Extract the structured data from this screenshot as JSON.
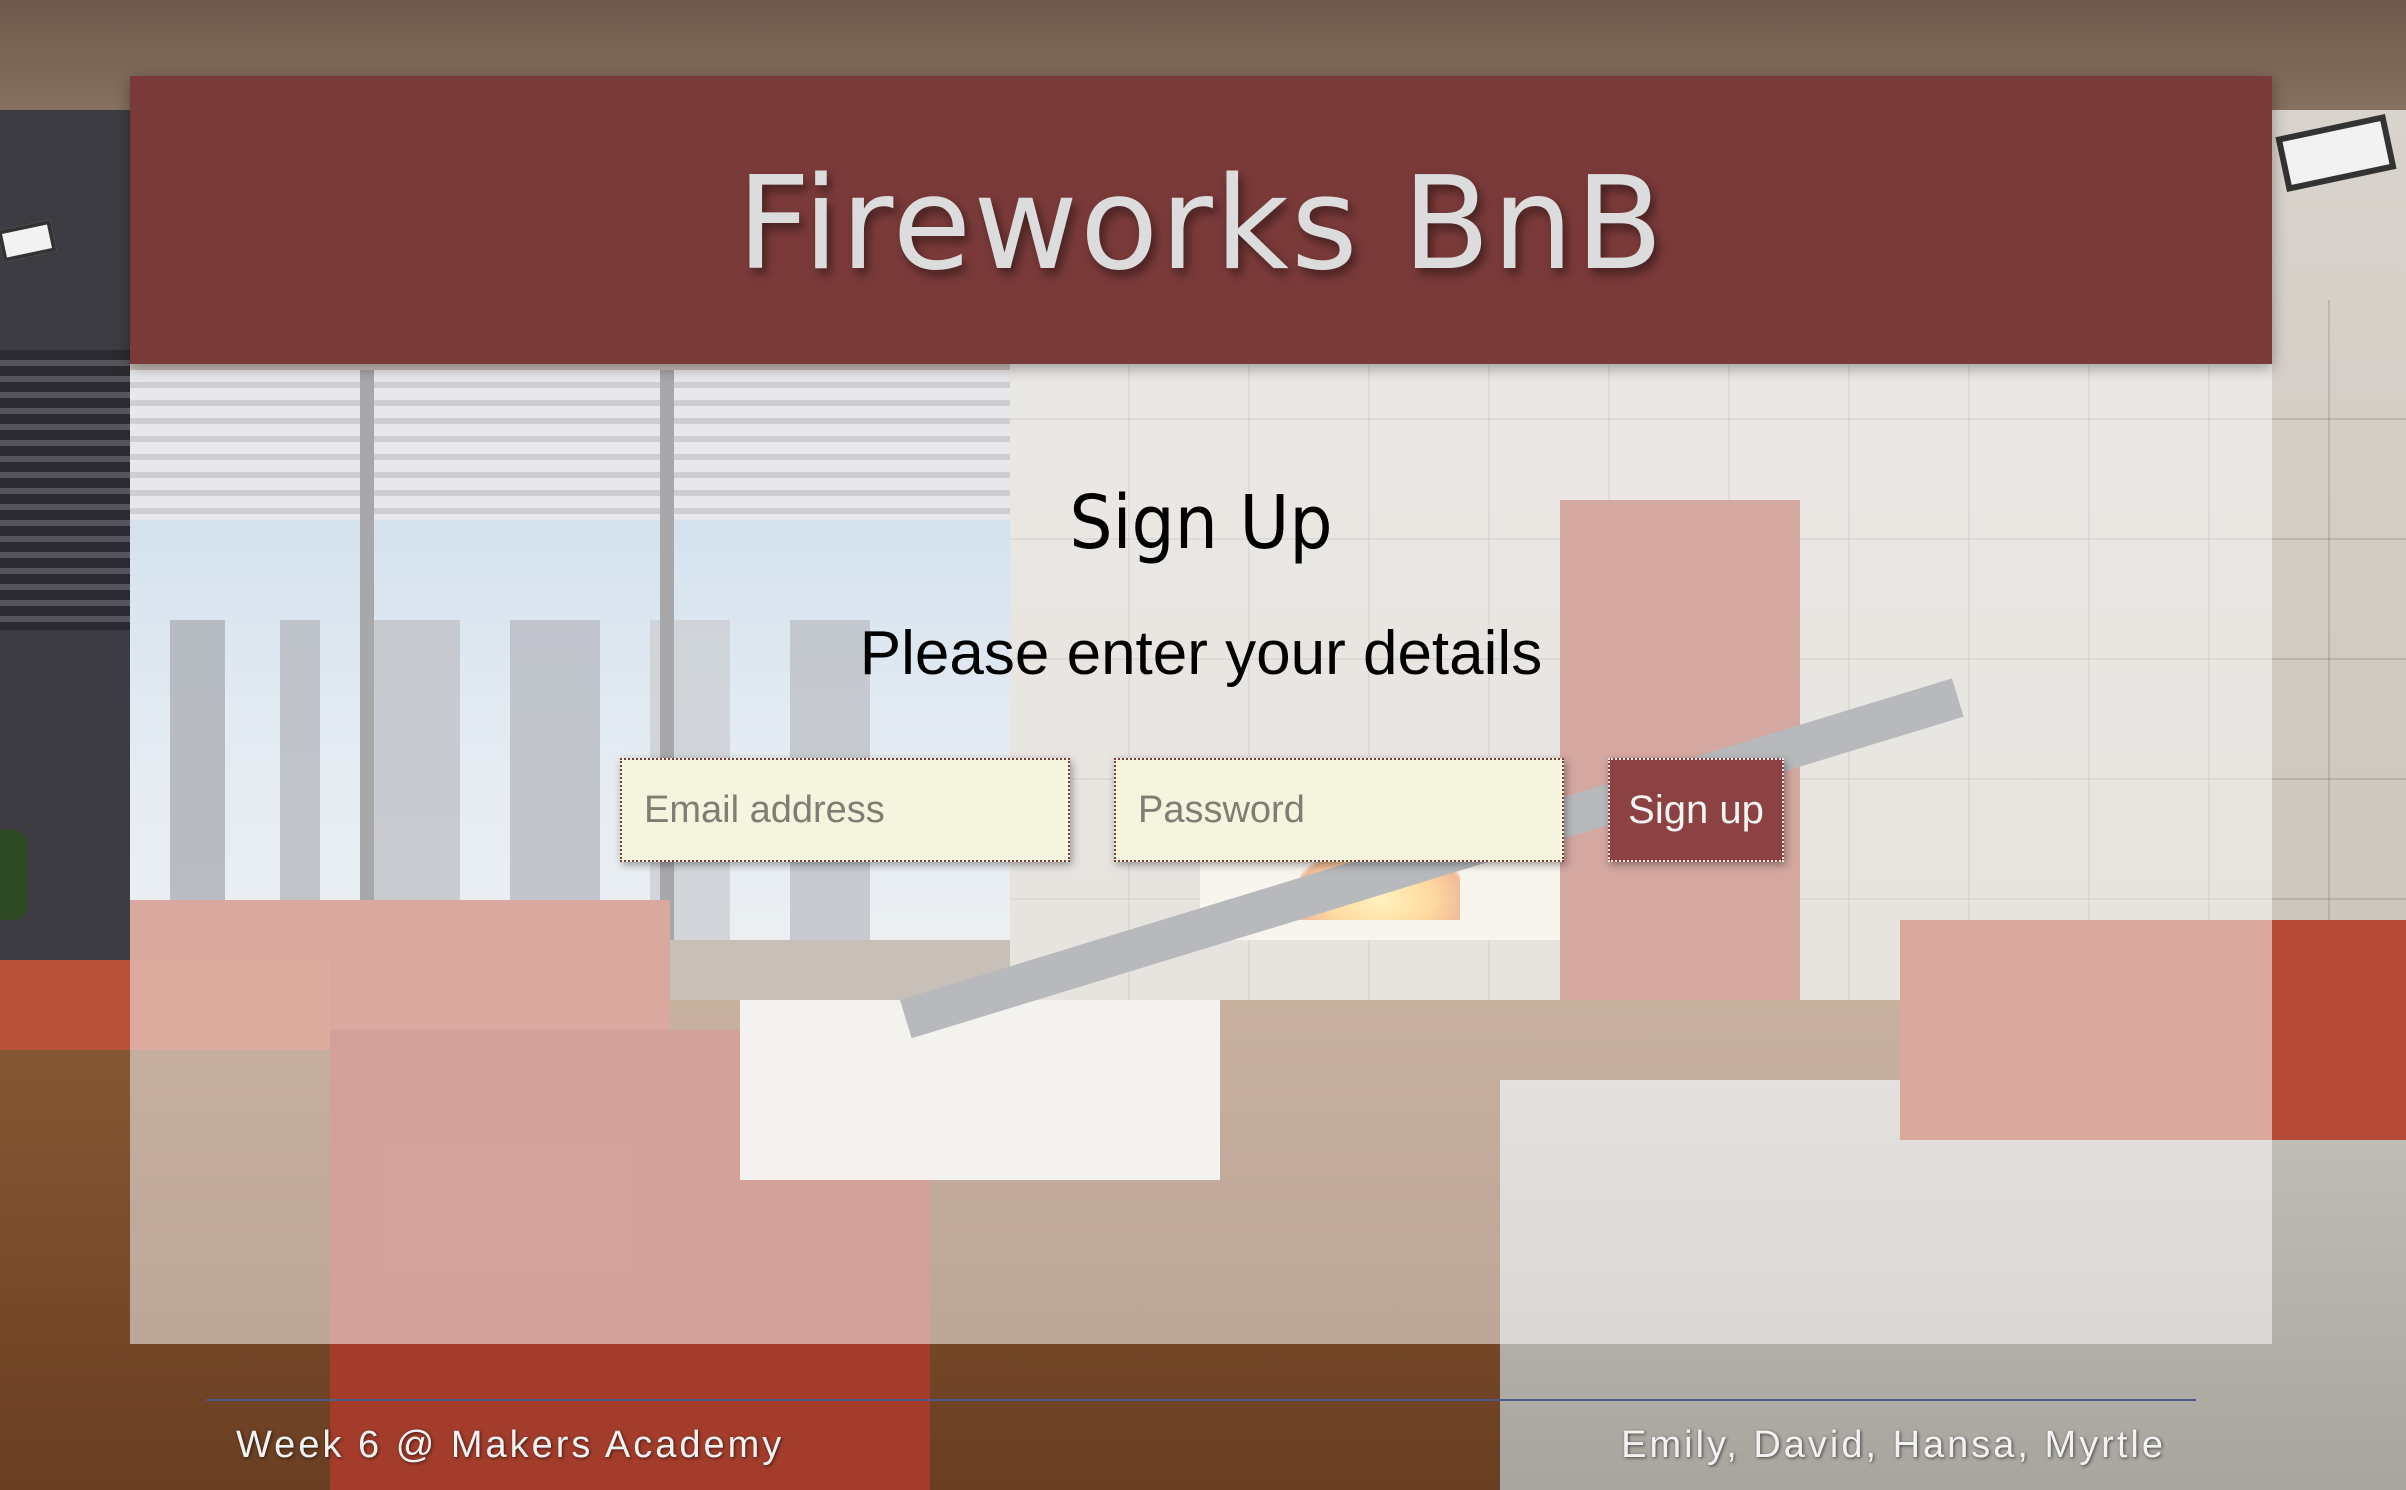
{
  "header": {
    "site_title": "Fireworks BnB"
  },
  "main": {
    "page_title": "Sign Up",
    "subtitle": "Please enter your details",
    "form": {
      "email_placeholder": "Email address",
      "email_value": "",
      "password_placeholder": "Password",
      "password_value": "",
      "submit_label": "Sign up"
    }
  },
  "footer": {
    "left_text": "Week 6 @ Makers Academy",
    "right_text": "Emily, David, Hansa, Myrtle"
  },
  "colors": {
    "header_bg": "#7b3a3a",
    "button_bg": "#8c4242",
    "input_bg": "#f5f5df",
    "footer_rule": "#4f5a8a"
  }
}
